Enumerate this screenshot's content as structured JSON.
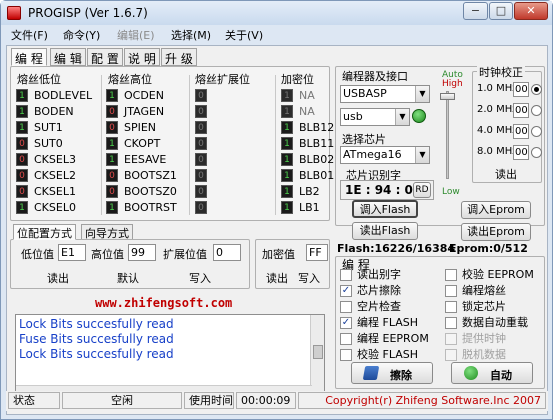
{
  "window": {
    "title": "PROGISP (Ver 1.6.7)",
    "min_label": "−",
    "max_label": "□",
    "close_label": "✕"
  },
  "menu": [
    "文件(F)",
    "命令(Y)",
    "编辑(E)",
    "选择(M)",
    "关于(V)"
  ],
  "tabs": [
    "编 程",
    "编 辑",
    "配 置",
    "说 明",
    "升 级"
  ],
  "fuses": {
    "low": {
      "title": "熔丝低位",
      "bits": [
        {
          "val": "1",
          "name": "BODLEVEL"
        },
        {
          "val": "1",
          "name": "BODEN"
        },
        {
          "val": "1",
          "name": "SUT1"
        },
        {
          "val": "0",
          "name": "SUT0"
        },
        {
          "val": "0",
          "name": "CKSEL3"
        },
        {
          "val": "0",
          "name": "CKSEL2"
        },
        {
          "val": "0",
          "name": "CKSEL1"
        },
        {
          "val": "1",
          "name": "CKSEL0"
        }
      ]
    },
    "high": {
      "title": "熔丝高位",
      "bits": [
        {
          "val": "1",
          "name": "OCDEN"
        },
        {
          "val": "0",
          "name": "JTAGEN"
        },
        {
          "val": "0",
          "name": "SPIEN"
        },
        {
          "val": "1",
          "name": "CKOPT"
        },
        {
          "val": "1",
          "name": "EESAVE"
        },
        {
          "val": "0",
          "name": "BOOTSZ1"
        },
        {
          "val": "0",
          "name": "BOOTSZ0"
        },
        {
          "val": "1",
          "name": "BOOTRST"
        }
      ]
    },
    "ext": {
      "title": "熔丝扩展位",
      "bits": [
        "0",
        "0",
        "0",
        "0",
        "0",
        "0",
        "0",
        "0"
      ]
    },
    "lock": {
      "title": "加密位",
      "bits": [
        {
          "val": "1",
          "name": "NA"
        },
        {
          "val": "1",
          "name": "NA"
        },
        {
          "val": "1",
          "name": "BLB12"
        },
        {
          "val": "1",
          "name": "BLB11"
        },
        {
          "val": "1",
          "name": "BLB02"
        },
        {
          "val": "1",
          "name": "BLB01"
        },
        {
          "val": "1",
          "name": "LB2"
        },
        {
          "val": "1",
          "name": "LB1"
        }
      ]
    }
  },
  "subtabs": [
    "位配置方式",
    "向导方式"
  ],
  "fuse_values": {
    "low_label": "低位值",
    "low_value": "E1",
    "high_label": "高位值",
    "high_value": "99",
    "ext_label": "扩展位值",
    "ext_value": "0",
    "lock_label": "加密值",
    "lock_value": "FF",
    "read": "读出",
    "default": "默认",
    "write": "写入",
    "lock_read": "读出",
    "lock_write": "写入"
  },
  "website": "www.zhifengsoft.com",
  "log": [
    "Lock Bits succesfully read",
    "Fuse Bits succesfully read",
    "Lock Bits succesfully read"
  ],
  "programmer": {
    "title": "编程器及接口",
    "device": "USBASP",
    "port": "usb"
  },
  "chip": {
    "title": "选择芯片",
    "name": "ATmega16"
  },
  "chip_id": {
    "title": "芯片识别字",
    "value": "1E : 94 : 03",
    "rd_label": "RD"
  },
  "speed": {
    "auto": "Auto",
    "high": "High",
    "low": "Low"
  },
  "clock": {
    "title": "时钟校正",
    "rows": [
      {
        "freq": "1.0 MHz",
        "val": "00",
        "selected": true
      },
      {
        "freq": "2.0 MHz",
        "val": "00",
        "selected": false
      },
      {
        "freq": "4.0 MHz",
        "val": "00",
        "selected": false
      },
      {
        "freq": "8.0 MHz",
        "val": "00",
        "selected": false
      }
    ],
    "read": "读出"
  },
  "buttons": {
    "load_flash": "调入Flash",
    "read_flash": "读出Flash",
    "load_eprom": "调入Eprom",
    "read_eprom": "读出Eprom"
  },
  "sizes": {
    "flash": "Flash:16226/16384",
    "eprom": "Eprom:0/512"
  },
  "program": {
    "title": "编 程",
    "options": [
      {
        "label": "读出别字",
        "checked": false,
        "enabled": true
      },
      {
        "label": "校验 EEPROM",
        "checked": false,
        "enabled": true
      },
      {
        "label": "芯片擦除",
        "checked": true,
        "enabled": true
      },
      {
        "label": "编程熔丝",
        "checked": false,
        "enabled": true
      },
      {
        "label": "空片检查",
        "checked": false,
        "enabled": true
      },
      {
        "label": "锁定芯片",
        "checked": false,
        "enabled": true
      },
      {
        "label": "编程 FLASH",
        "checked": true,
        "enabled": true
      },
      {
        "label": "数据自动重载",
        "checked": false,
        "enabled": true
      },
      {
        "label": "编程 EEPROM",
        "checked": false,
        "enabled": true
      },
      {
        "label": "提供时钟",
        "checked": false,
        "enabled": false
      },
      {
        "label": "校验 FLASH",
        "checked": false,
        "enabled": true
      },
      {
        "label": "脱机数据",
        "checked": false,
        "enabled": false
      }
    ],
    "erase": "擦除",
    "auto": "自动"
  },
  "status": {
    "state_label": "状态",
    "state": "空闲",
    "time_label": "使用时间",
    "time": "00:00:09",
    "copyright": "Copyright(r) Zhifeng Software.Inc 2007"
  },
  "colors": {
    "bit_on": "#4cd04c",
    "log_text": "#1740c8",
    "website": "#c00000",
    "copyright": "#c00000",
    "led": "#1e8a1e"
  }
}
